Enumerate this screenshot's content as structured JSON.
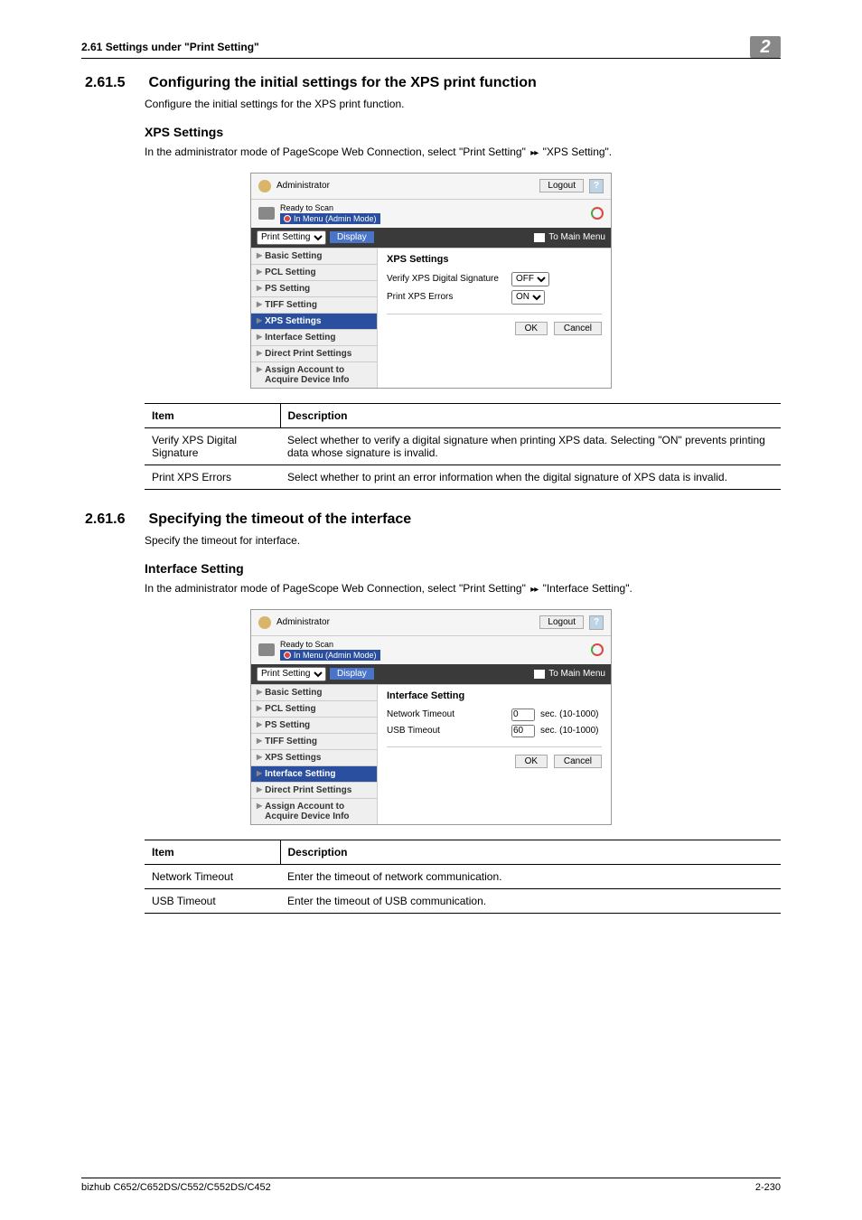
{
  "header": {
    "left": "2.61    Settings under \"Print Setting\"",
    "chapter": "2"
  },
  "sec1": {
    "num": "2.61.5",
    "title": "Configuring the initial settings for the XPS print function",
    "intro": "Configure the initial settings for the XPS print function.",
    "sub": "XPS Settings",
    "subintro_pre": "In the administrator mode of PageScope Web Connection, select \"Print Setting\" ",
    "subintro_post": " \"XPS Setting\"."
  },
  "sec2": {
    "num": "2.61.6",
    "title": "Specifying the timeout of the interface",
    "intro": "Specify the timeout for interface.",
    "sub": "Interface Setting",
    "subintro_pre": "In the administrator mode of PageScope Web Connection, select \"Print Setting\" ",
    "subintro_post": " \"Interface Setting\"."
  },
  "ss_common": {
    "admin": "Administrator",
    "logout": "Logout",
    "help": "?",
    "ready": "Ready to Scan",
    "menu_mode": "In Menu (Admin Mode)",
    "select": "Print Setting",
    "display": "Display",
    "to_main": "To Main Menu",
    "side": [
      "Basic Setting",
      "PCL Setting",
      "PS Setting",
      "TIFF Setting",
      "XPS Settings",
      "Interface Setting",
      "Direct Print Settings",
      "Assign Account to Acquire Device Info"
    ],
    "ok": "OK",
    "cancel": "Cancel"
  },
  "ss1": {
    "title": "XPS Settings",
    "row1_label": "Verify XPS Digital Signature",
    "row1_val": "OFF",
    "row2_label": "Print XPS Errors",
    "row2_val": "ON"
  },
  "ss2": {
    "title": "Interface Setting",
    "row1_label": "Network Timeout",
    "row1_val": "0",
    "row1_unit": "sec. (10-1000)",
    "row2_label": "USB Timeout",
    "row2_val": "60",
    "row2_unit": "sec. (10-1000)"
  },
  "table1": {
    "h1": "Item",
    "h2": "Description",
    "r1c1": "Verify XPS Digital Signature",
    "r1c2": "Select whether to verify a digital signature when printing XPS data. Selecting \"ON\" prevents printing data whose signature is invalid.",
    "r2c1": "Print XPS Errors",
    "r2c2": "Select whether to print an error information when the digital signature of XPS data is invalid."
  },
  "table2": {
    "h1": "Item",
    "h2": "Description",
    "r1c1": "Network Timeout",
    "r1c2": "Enter the timeout of network communication.",
    "r2c1": "USB Timeout",
    "r2c2": "Enter the timeout of USB communication."
  },
  "footer": {
    "model": "bizhub C652/C652DS/C552/C552DS/C452",
    "page": "2-230"
  }
}
